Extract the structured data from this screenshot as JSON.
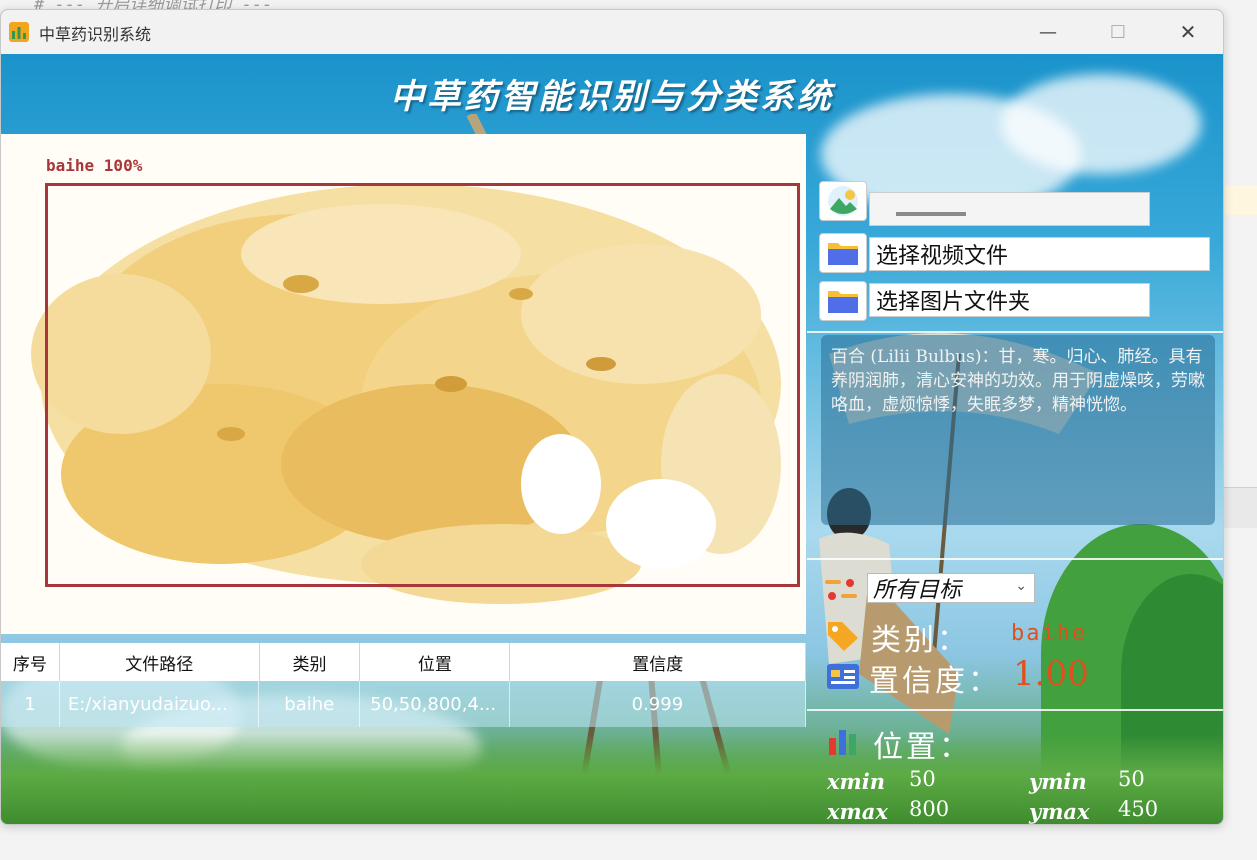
{
  "background": {
    "code_snippet": "# --- 开启详细调试打印 ---"
  },
  "window": {
    "title": "中草药识别系统",
    "controls": {
      "minimize": "—",
      "maximize": "☐",
      "close": "✕"
    }
  },
  "header": {
    "title": "中草药智能识别与分类系统"
  },
  "detection": {
    "label": "baihe 100%"
  },
  "table": {
    "headers": [
      "序号",
      "文件路径",
      "类别",
      "位置",
      "置信度"
    ],
    "rows": [
      [
        "1",
        "E:/xianyudaizuo...",
        "baihe",
        "50,50,800,4...",
        "0.999"
      ]
    ]
  },
  "sidebar": {
    "video_file_label": "选择视频文件",
    "image_folder_label": "选择图片文件夹",
    "description": "百合 (Lilii Bulbus)：甘，寒。归心、肺经。具有养阴润肺，清心安神的功效。用于阴虚燥咳，劳嗽咯血，虚烦惊悸，失眠多梦，精神恍惚。",
    "target_select": "所有目标",
    "class_label": "类别：",
    "class_value": "baihe",
    "confidence_label": "置信度：",
    "confidence_value": "1.00",
    "position_label": "位置：",
    "xmin_label": "xmin",
    "xmin_value": "50",
    "ymin_label": "ymin",
    "ymin_value": "50",
    "xmax_label": "xmax",
    "xmax_value": "800",
    "ymax_label": "ymax",
    "ymax_value": "450"
  },
  "colors": {
    "detection_box": "#a8363a",
    "accent_red": "#e0501e",
    "background_blue": "#1f9bd0"
  }
}
